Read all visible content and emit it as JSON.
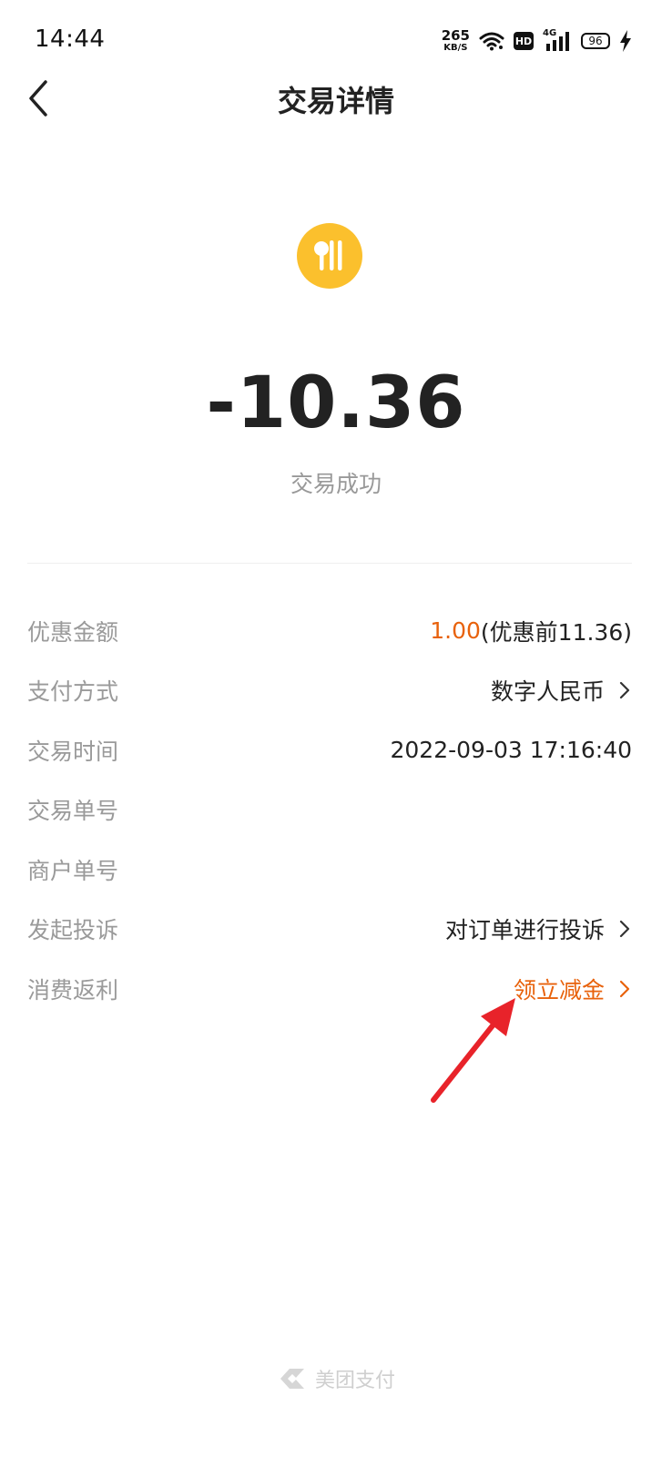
{
  "status_bar": {
    "time": "14:44",
    "net_speed_value": "265",
    "net_speed_unit": "KB/S",
    "hd_label": "HD",
    "network_type": "4G",
    "battery": "96"
  },
  "header": {
    "title": "交易详情"
  },
  "merchant": {
    "icon": "restaurant-icon",
    "icon_color": "#FBC02D"
  },
  "transaction": {
    "amount": "-10.36",
    "status": "交易成功"
  },
  "details": [
    {
      "label": "优惠金额",
      "value_accent": "1.00",
      "value": "(优惠前11.36)"
    },
    {
      "label": "支付方式",
      "value": "数字人民币"
    },
    {
      "label": "交易时间",
      "value": "2022-09-03 17:16:40"
    },
    {
      "label": "交易单号",
      "value": ""
    },
    {
      "label": "商户单号",
      "value": ""
    },
    {
      "label": "发起投诉",
      "value": "对订单进行投诉"
    },
    {
      "label": "消费返利",
      "value": "领立减金"
    }
  ],
  "footer": {
    "brand": "美团支付",
    "logo": "meituan-pay-logo-icon"
  },
  "colors": {
    "accent": "#E8620C",
    "annotation": "#E8232A"
  }
}
